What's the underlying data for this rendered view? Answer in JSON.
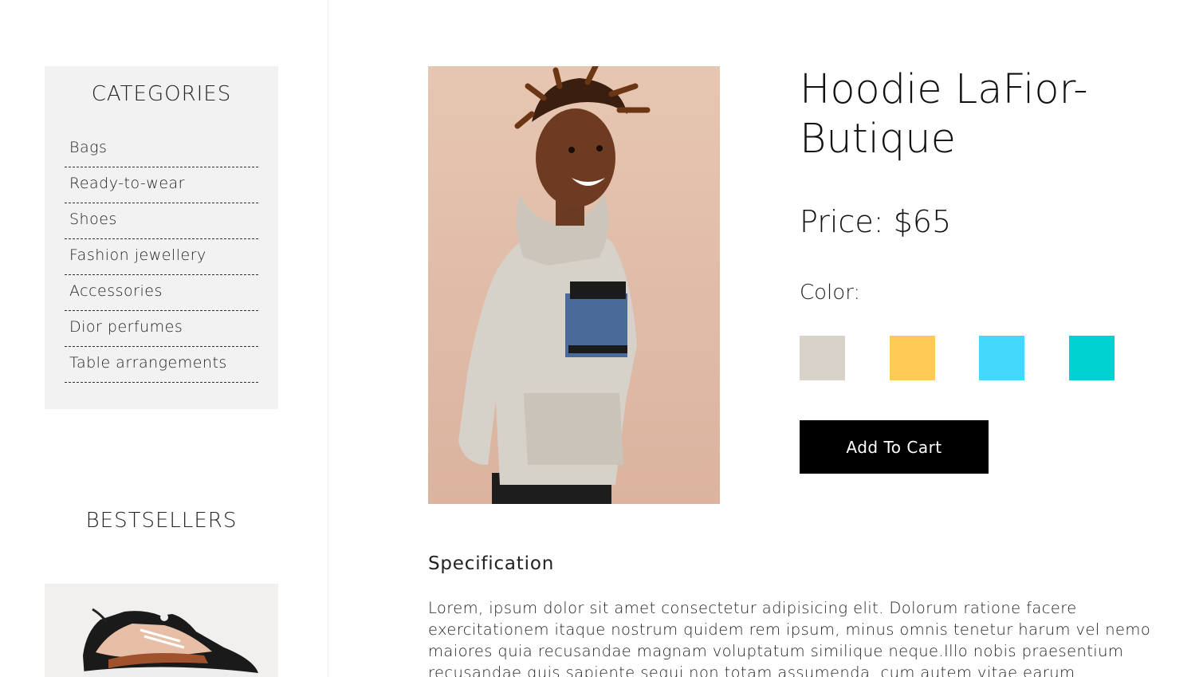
{
  "sidebar": {
    "categories_title": "CATEGORIES",
    "categories": [
      {
        "label": "Bags"
      },
      {
        "label": "Ready-to-wear"
      },
      {
        "label": "Shoes"
      },
      {
        "label": "Fashion jewellery"
      },
      {
        "label": "Accessories"
      },
      {
        "label": "Dior perfumes"
      },
      {
        "label": "Table arrangements"
      }
    ],
    "bestsellers_title": "BESTSELLERS"
  },
  "product": {
    "title": "Hoodie LaFior-Butique",
    "price_label": "Price:",
    "price_value": "$65",
    "color_label": "Color:",
    "colors": [
      "#d8d2ca",
      "#ffca55",
      "#45d8fd",
      "#00d2d2"
    ],
    "add_to_cart": "Add To Cart",
    "spec_title": "Specification",
    "spec_text": "Lorem, ipsum dolor sit amet consectetur adipisicing elit. Dolorum ratione facere exercitationem itaque nostrum quidem rem ipsum, minus omnis tenetur harum vel nemo maiores quia recusandae magnam voluptatum similique neque.Illo nobis praesentium recusandae quis sapiente sequi non totam assumenda, cum autem vitae earum obcaecati"
  }
}
